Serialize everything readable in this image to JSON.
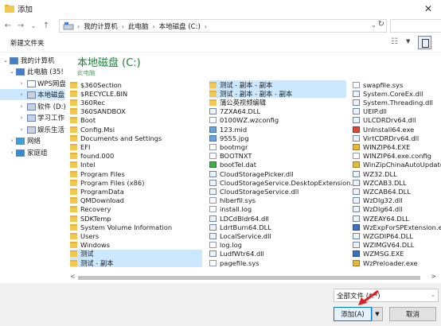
{
  "window": {
    "title": "添加",
    "close_glyph": "✕"
  },
  "address_bar": {
    "back": "←",
    "forward": "→",
    "recent": "⌄",
    "up": "↑",
    "breadcrumbs": [
      "我的计算机",
      "此电脑",
      "本地磁盘 (C:)"
    ],
    "separator": "›",
    "dropdown_glyph": "⌄",
    "refresh_glyph": "↻"
  },
  "toolbar": {
    "new_folder_label": "新建文件夹",
    "view_glyph": "☷",
    "view_dropdown_glyph": "▼"
  },
  "nav_tree": [
    {
      "label": "我的计算机",
      "arrow": "⌄",
      "icon": "computer-icon"
    },
    {
      "label": "此电脑 (35!",
      "arrow": "⌄",
      "icon": "pc-icon"
    },
    {
      "label": "WPS网盘",
      "arrow": "›",
      "icon": "cloud-icon"
    },
    {
      "label": "本地磁盘",
      "arrow": "›",
      "icon": "drive-icon",
      "selected": true
    },
    {
      "label": "软件 (D:)",
      "arrow": "›",
      "icon": "drive-icon"
    },
    {
      "label": "学习工作",
      "arrow": "›",
      "icon": "drive-icon"
    },
    {
      "label": "娱乐生活",
      "arrow": "›",
      "icon": "drive-icon"
    },
    {
      "label": "网络",
      "arrow": "›",
      "icon": "network-icon"
    },
    {
      "label": "家庭组",
      "arrow": "›",
      "icon": "homegroup-icon"
    }
  ],
  "location": {
    "title": "本地磁盘 (C:)",
    "subtitle": "此电脑"
  },
  "columns": [
    [
      {
        "name": "$360Section",
        "type": "folder"
      },
      {
        "name": "$RECYCLE.BIN",
        "type": "folder"
      },
      {
        "name": "360Rec",
        "type": "folder"
      },
      {
        "name": "360SANDBOX",
        "type": "folder"
      },
      {
        "name": "Boot",
        "type": "folder"
      },
      {
        "name": "Config.Msi",
        "type": "folder"
      },
      {
        "name": "Documents and Settings",
        "type": "folder"
      },
      {
        "name": "EFI",
        "type": "folder"
      },
      {
        "name": "found.000",
        "type": "folder"
      },
      {
        "name": "Intel",
        "type": "folder"
      },
      {
        "name": "Program Files",
        "type": "folder"
      },
      {
        "name": "Program Files (x86)",
        "type": "folder"
      },
      {
        "name": "ProgramData",
        "type": "folder"
      },
      {
        "name": "QMDownload",
        "type": "folder"
      },
      {
        "name": "Recovery",
        "type": "folder"
      },
      {
        "name": "SDKTemp",
        "type": "folder"
      },
      {
        "name": "System Volume Information",
        "type": "folder"
      },
      {
        "name": "Users",
        "type": "folder"
      },
      {
        "name": "Windows",
        "type": "folder"
      },
      {
        "name": "测试",
        "type": "folder",
        "selected": true
      },
      {
        "name": "测试 - 副本",
        "type": "folder",
        "selected": true
      }
    ],
    [
      {
        "name": "测试 - 副本 - 副本",
        "type": "folder",
        "selected": true
      },
      {
        "name": "测试 - 副本 - 副本 - 副本",
        "type": "folder",
        "selected": true
      },
      {
        "name": "蒲公英视频编辑",
        "type": "folder"
      },
      {
        "name": "7ZXA64.DLL",
        "type": "sys"
      },
      {
        "name": "0100WZ.wzconfig",
        "type": "file"
      },
      {
        "name": "123.mid",
        "type": "img"
      },
      {
        "name": "9555.jpg",
        "type": "img"
      },
      {
        "name": "bootmgr",
        "type": "file"
      },
      {
        "name": "BOOTNXT",
        "type": "file"
      },
      {
        "name": "bootTel.dat",
        "type": "green"
      },
      {
        "name": "CloudStoragePicker.dll",
        "type": "sys"
      },
      {
        "name": "CloudStorageService.DesktopExtension.dll",
        "type": "sys"
      },
      {
        "name": "CloudStorageService.dll",
        "type": "sys"
      },
      {
        "name": "hiberfil.sys",
        "type": "file"
      },
      {
        "name": "install.log",
        "type": "file"
      },
      {
        "name": "LDCdBldr64.dll",
        "type": "sys"
      },
      {
        "name": "LdrtBurn64.DLL",
        "type": "sys"
      },
      {
        "name": "LocalService.dll",
        "type": "sys"
      },
      {
        "name": "log.log",
        "type": "file"
      },
      {
        "name": "LudfWtr64.dll",
        "type": "sys"
      },
      {
        "name": "pagefile.sys",
        "type": "file"
      }
    ],
    [
      {
        "name": "swapfile.sys",
        "type": "file"
      },
      {
        "name": "System.CoreEx.dll",
        "type": "sys"
      },
      {
        "name": "System.Threading.dll",
        "type": "sys"
      },
      {
        "name": "UEIP.dll",
        "type": "sys"
      },
      {
        "name": "ULCDRDrv64.dll",
        "type": "sys"
      },
      {
        "name": "UnInstall64.exe",
        "type": "red"
      },
      {
        "name": "VirtCDRDrv64.dll",
        "type": "sys"
      },
      {
        "name": "WINZIP64.EXE",
        "type": "zip"
      },
      {
        "name": "WINZIP64.exe.config",
        "type": "file"
      },
      {
        "name": "WinZipChinaAutoUpdater",
        "type": "zip"
      },
      {
        "name": "WZ32.DLL",
        "type": "sys"
      },
      {
        "name": "WZCAB3.DLL",
        "type": "sys"
      },
      {
        "name": "WZCAB64.DLL",
        "type": "sys"
      },
      {
        "name": "WzDlg32.dll",
        "type": "sys"
      },
      {
        "name": "WzDlg64.dll",
        "type": "sys"
      },
      {
        "name": "WZEAY64.DLL",
        "type": "sys"
      },
      {
        "name": "WzExpForSPExtension.exe",
        "type": "exe"
      },
      {
        "name": "WZGDIP64.DLL",
        "type": "sys"
      },
      {
        "name": "WZIMGV64.DLL",
        "type": "sys"
      },
      {
        "name": "WZMSG.EXE",
        "type": "exe"
      },
      {
        "name": "WzPreloader.exe",
        "type": "zip"
      }
    ]
  ],
  "scrollbar": {
    "left_glyph": "<",
    "right_glyph": ">"
  },
  "footer": {
    "filetype_value": "全部文件 (*.*)",
    "filetype_arrow": "⌄",
    "add_label": "添加(A)",
    "add_dropdown_glyph": "▼",
    "cancel_label": "取消"
  },
  "colors": {
    "accent": "#0078d7",
    "selection": "#cce8ff",
    "annotation_arrow": "#e02020",
    "location_title": "#1e7f3a"
  }
}
